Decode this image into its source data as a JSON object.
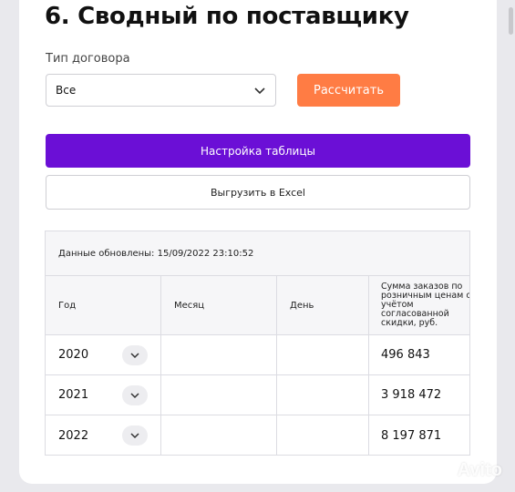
{
  "header": {
    "title": "6. Сводный по поставщику"
  },
  "filters": {
    "contract_type_label": "Тип договора",
    "contract_type_value": "Все",
    "calculate_label": "Рассчитать"
  },
  "actions": {
    "table_settings_label": "Настройка таблицы",
    "export_excel_label": "Выгрузить в Excel"
  },
  "table": {
    "updated": "Данные обновлены: 15/09/2022 23:10:52",
    "columns": [
      "Год",
      "Месяц",
      "День",
      "Сумма заказов по розничным ценам с учётом согласованной скидки, руб."
    ],
    "rows": [
      {
        "year": "2020",
        "month": "",
        "day": "",
        "sum": "496 843"
      },
      {
        "year": "2021",
        "month": "",
        "day": "",
        "sum": "3 918 472"
      },
      {
        "year": "2022",
        "month": "",
        "day": "",
        "sum": "8 197 871"
      }
    ]
  },
  "watermark": {
    "text": "Avito"
  },
  "colors": {
    "accent": "#6b0fd6",
    "primary_button": "#ff7c44"
  },
  "icons": {
    "select_chevron": "chevron-down-icon",
    "row_expander": "chevron-down-icon"
  }
}
